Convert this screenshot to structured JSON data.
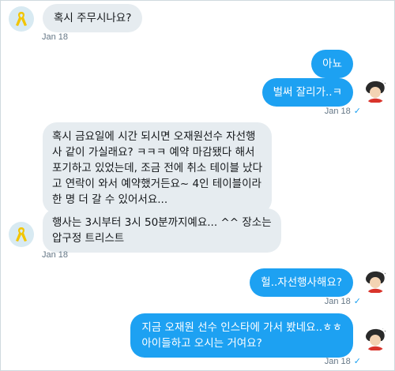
{
  "messages": [
    {
      "text": "혹시 주무시나요?",
      "time": "Jan 18"
    },
    {
      "text": "아뇨"
    },
    {
      "text": "벌써 잘리가..ㅋ",
      "time": "Jan 18",
      "seen": "✓"
    },
    {
      "text": "혹시 금요일에 시간 되시면 오재원선수 자선행\n사 같이 가실래요? ㅋㅋㅋ 예약 마감됐다 해서\n포기하고 있었는데, 조금 전에 취소 테이블 났다\n고 연락이 와서 예약했거든요~ 4인 테이블이라\n한 명 더 갈 수 있어서요..."
    },
    {
      "text": "행사는 3시부터 3시 50분까지예요... ^^ 장소는\n압구정 트리스트",
      "time": "Jan 18"
    },
    {
      "text": "헐..자선행사해요?",
      "time": "Jan 18",
      "seen": "✓"
    },
    {
      "text": "지금 오재원 선수 인스타에 가서 봤네요..ㅎㅎ\n아이들하고 오시는 거여요?",
      "time": "Jan 18",
      "seen": "✓"
    }
  ],
  "colors": {
    "incoming_bg": "#e6ecf0",
    "outgoing_bg": "#1da1f2",
    "meta_text": "#657786"
  }
}
